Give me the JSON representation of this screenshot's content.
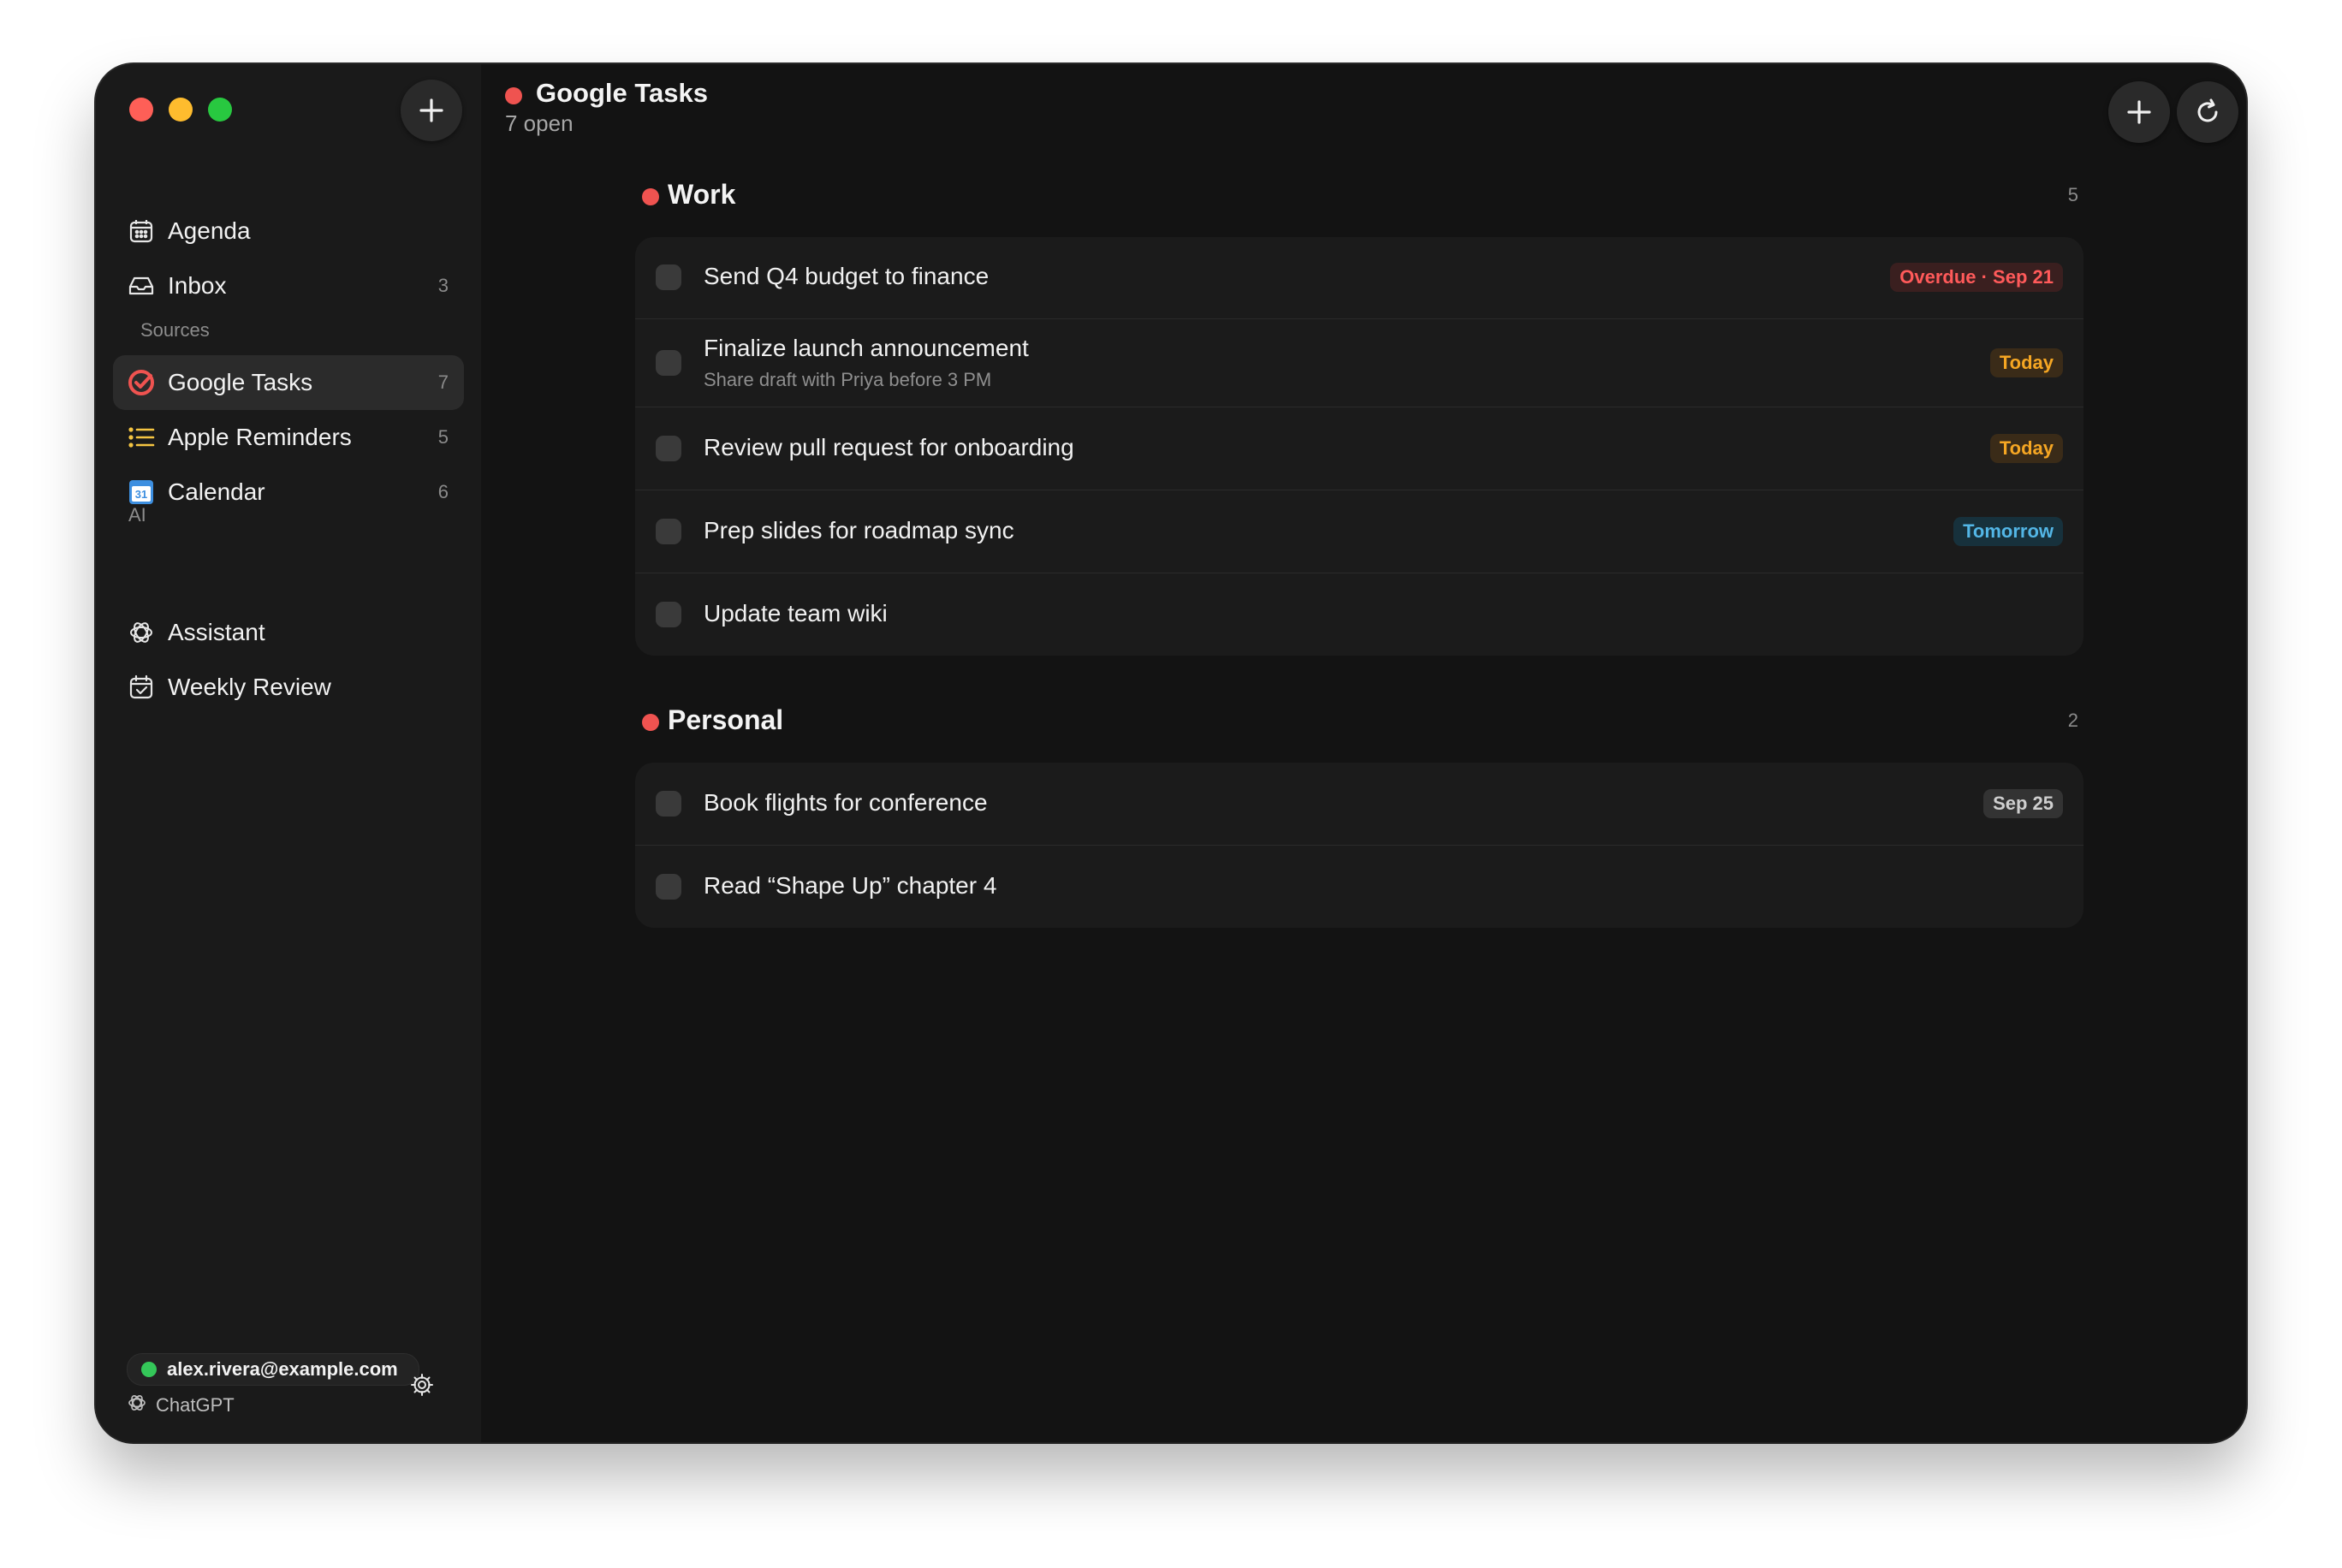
{
  "sidebar": {
    "nav": [
      {
        "label": "Agenda",
        "icon": "calendar-grid-icon"
      },
      {
        "label": "Inbox",
        "icon": "inbox-tray-icon",
        "count": "3"
      }
    ],
    "sources_label": "Sources",
    "sources": [
      {
        "label": "Google Tasks",
        "icon": "google-tasks-icon",
        "count": "7",
        "active": true
      },
      {
        "label": "Apple Reminders",
        "icon": "list-icon",
        "count": "5"
      },
      {
        "label": "Calendar",
        "icon": "calendar-31-icon",
        "count": "6"
      }
    ],
    "ai_label": "AI",
    "ai_items": [
      {
        "label": "Assistant",
        "icon": "openai-icon"
      },
      {
        "label": "Weekly Review",
        "icon": "calendar-check-icon"
      }
    ],
    "account": {
      "email": "alex.rivera@example.com",
      "status_color": "#34c759"
    },
    "provider": "ChatGPT"
  },
  "header": {
    "title": "Google Tasks",
    "subtitle": "7 open",
    "accent": "#ef5350"
  },
  "groups": [
    {
      "title": "Work",
      "count": "5",
      "tasks": [
        {
          "title": "Send Q4 budget to finance",
          "badge": "Overdue · Sep 21",
          "badge_type": "overdue"
        },
        {
          "title": "Finalize launch announcement",
          "note": "Share draft with Priya before 3 PM",
          "badge": "Today",
          "badge_type": "today"
        },
        {
          "title": "Review pull request for onboarding",
          "badge": "Today",
          "badge_type": "today"
        },
        {
          "title": "Prep slides for roadmap sync",
          "badge": "Tomorrow",
          "badge_type": "tomorrow"
        },
        {
          "title": "Update team wiki"
        }
      ]
    },
    {
      "title": "Personal",
      "count": "2",
      "tasks": [
        {
          "title": "Book flights for conference",
          "badge": "Sep 25",
          "badge_type": "date"
        },
        {
          "title": "Read “Shape Up” chapter 4"
        }
      ]
    }
  ],
  "colors": {
    "overdue": "#ff5a5a",
    "today": "#f5a623",
    "tomorrow": "#53b6e6"
  }
}
